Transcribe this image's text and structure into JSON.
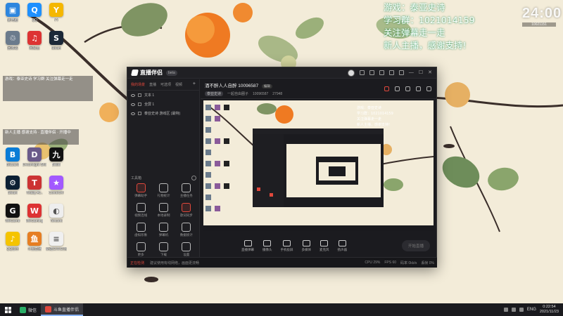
{
  "stream_overlay": {
    "lines": [
      "游戏：泰亚史诗",
      "学习群：1021014159",
      "关注弹幕走一走",
      "新人主播，感谢支持!"
    ]
  },
  "clock_widget": {
    "big": "24:00",
    "small": "10021151"
  },
  "desktop": {
    "icons": [
      {
        "label": "此电脑",
        "color": "#2e86de",
        "glyph": "▣"
      },
      {
        "label": "QQ",
        "color": "#1e90ff",
        "glyph": "Q"
      },
      {
        "label": "YY",
        "color": "#f5b700",
        "glyph": "Y"
      },
      {
        "label": "回收站",
        "color": "#6b7b8c",
        "glyph": "♲"
      },
      {
        "label": "网易云",
        "color": "#d33",
        "glyph": "♫"
      },
      {
        "label": "Steam",
        "color": "#1b2838",
        "glyph": "S"
      },
      {
        "label": "Blizzard",
        "color": "#0a7cd6",
        "glyph": "B"
      },
      {
        "label": "Dreamlight Shinergy",
        "color": "#6a5a8a",
        "glyph": "D"
      },
      {
        "label": "Bilibili",
        "color": "#111",
        "glyph": "九"
      },
      {
        "label": "Steam",
        "color": "#0c1f33",
        "glyph": "⚙"
      },
      {
        "label": "Totally Ac..",
        "color": "#c33",
        "glyph": "T"
      },
      {
        "label": "ComeOn!",
        "color": "#a259ff",
        "glyph": "★"
      },
      {
        "label": "WeGame",
        "color": "#111",
        "glyph": "G"
      },
      {
        "label": "WeGaming",
        "color": "#d33",
        "glyph": "W"
      },
      {
        "label": "Tencent",
        "color": "#eee",
        "glyph": "◐"
      },
      {
        "label": "QQ音乐",
        "color": "#f5c400",
        "glyph": "♪"
      },
      {
        "label": "斗鱼直播",
        "color": "#e67e22",
        "glyph": "鱼"
      },
      {
        "label": "新建文本文档",
        "color": "#f0f0f0",
        "glyph": "≡"
      }
    ],
    "overlay_boxes": [
      "游戏：泰亚史诗 学习群 关注弹幕走一走",
      "新人主播 感谢支持 · 直播伴侣 · 开播中"
    ]
  },
  "app": {
    "name": "直播伴侣",
    "version": "beta",
    "tabs": [
      "我的场景",
      "直播",
      "可选项",
      "视频"
    ],
    "scenes": [
      {
        "label": "文本 1"
      },
      {
        "label": "全屏 1"
      },
      {
        "label": "泰亚史诗 游戏区 (最特)"
      }
    ],
    "toolbox_title": "工具箱",
    "tools": [
      {
        "label": "弹幕助手",
        "accent": true
      },
      {
        "label": "礼物统计",
        "accent": false
      },
      {
        "label": "主播任务",
        "accent": false
      },
      {
        "label": "视频连线",
        "accent": false
      },
      {
        "label": "本地录制",
        "accent": false
      },
      {
        "label": "歌词同步",
        "accent": true
      },
      {
        "label": "虚拟形象",
        "accent": false
      },
      {
        "label": "弹幕机",
        "accent": false
      },
      {
        "label": "数据统计",
        "accent": false
      },
      {
        "label": "更多",
        "accent": false
      },
      {
        "label": "下载",
        "accent": false
      },
      {
        "label": "设置",
        "accent": false
      }
    ],
    "room": {
      "title": "酒不醉人人自醉 10096587",
      "edit_label": "编辑",
      "tag": "泰亚史诗",
      "category": "一起自由圈子",
      "room_id": "10096587",
      "viewers": "27948"
    },
    "controls": [
      {
        "label": "直播弹幕"
      },
      {
        "label": "摄像头"
      },
      {
        "label": "手机投屏"
      },
      {
        "label": "多媒体"
      },
      {
        "label": "麦克风"
      },
      {
        "label": "扬声器"
      }
    ],
    "start_live": "开始直播",
    "status": {
      "warning": "正在检测",
      "tip": "建议使用有线网络，画面更流畅",
      "stats": [
        "CPU 29%",
        "FPS 60",
        "码率 0kb/s",
        "丢帧 0%"
      ]
    }
  },
  "taskbar": {
    "items": [
      {
        "label": "微信",
        "color": "#2aae67",
        "active": false
      },
      {
        "label": "斗鱼直播伴侣",
        "color": "#e0483c",
        "active": true
      }
    ],
    "tray": {
      "lang": "ENG",
      "time": "0:22:54",
      "date": "2021/11/23"
    }
  },
  "colors": {
    "accent": "#e0483c",
    "overlay_text": "#ffffff"
  }
}
